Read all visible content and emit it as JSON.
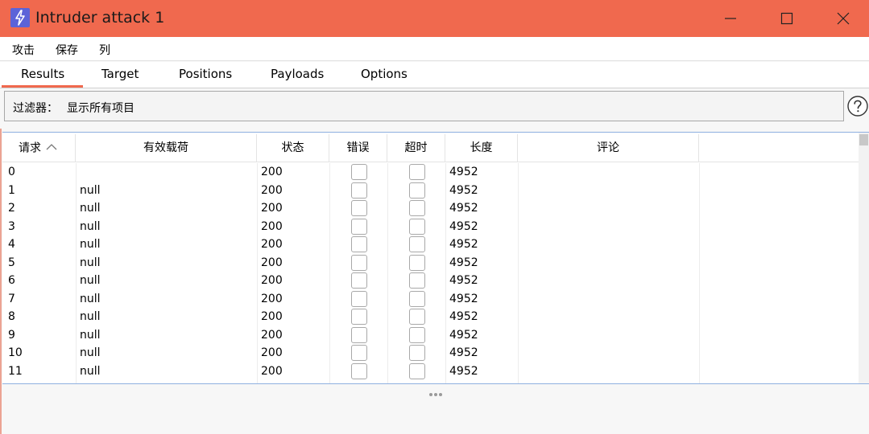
{
  "window": {
    "title": "Intruder attack 1",
    "accent_color": "#f0694e",
    "icon": "bolt-icon"
  },
  "menu": {
    "attack": "攻击",
    "save": "保存",
    "columns": "列"
  },
  "tabs": [
    {
      "label": "Results",
      "active": true
    },
    {
      "label": "Target"
    },
    {
      "label": "Positions"
    },
    {
      "label": "Payloads"
    },
    {
      "label": "Options"
    }
  ],
  "filter": {
    "label": "过滤器：",
    "value": "显示所有项目"
  },
  "table": {
    "columns": {
      "request": "请求",
      "payload": "有效载荷",
      "status": "状态",
      "error": "错误",
      "timeout": "超时",
      "length": "长度",
      "comment": "评论"
    },
    "sort_column": "request",
    "sort_direction": "ascending",
    "rows": [
      {
        "request": "0",
        "payload": "",
        "status": "200",
        "error": false,
        "timeout": false,
        "length": "4952",
        "comment": ""
      },
      {
        "request": "1",
        "payload": "null",
        "status": "200",
        "error": false,
        "timeout": false,
        "length": "4952",
        "comment": ""
      },
      {
        "request": "2",
        "payload": "null",
        "status": "200",
        "error": false,
        "timeout": false,
        "length": "4952",
        "comment": ""
      },
      {
        "request": "3",
        "payload": "null",
        "status": "200",
        "error": false,
        "timeout": false,
        "length": "4952",
        "comment": ""
      },
      {
        "request": "4",
        "payload": "null",
        "status": "200",
        "error": false,
        "timeout": false,
        "length": "4952",
        "comment": ""
      },
      {
        "request": "5",
        "payload": "null",
        "status": "200",
        "error": false,
        "timeout": false,
        "length": "4952",
        "comment": ""
      },
      {
        "request": "6",
        "payload": "null",
        "status": "200",
        "error": false,
        "timeout": false,
        "length": "4952",
        "comment": ""
      },
      {
        "request": "7",
        "payload": "null",
        "status": "200",
        "error": false,
        "timeout": false,
        "length": "4952",
        "comment": ""
      },
      {
        "request": "8",
        "payload": "null",
        "status": "200",
        "error": false,
        "timeout": false,
        "length": "4952",
        "comment": ""
      },
      {
        "request": "9",
        "payload": "null",
        "status": "200",
        "error": false,
        "timeout": false,
        "length": "4952",
        "comment": ""
      },
      {
        "request": "10",
        "payload": "null",
        "status": "200",
        "error": false,
        "timeout": false,
        "length": "4952",
        "comment": ""
      },
      {
        "request": "11",
        "payload": "null",
        "status": "200",
        "error": false,
        "timeout": false,
        "length": "4952",
        "comment": ""
      }
    ]
  }
}
